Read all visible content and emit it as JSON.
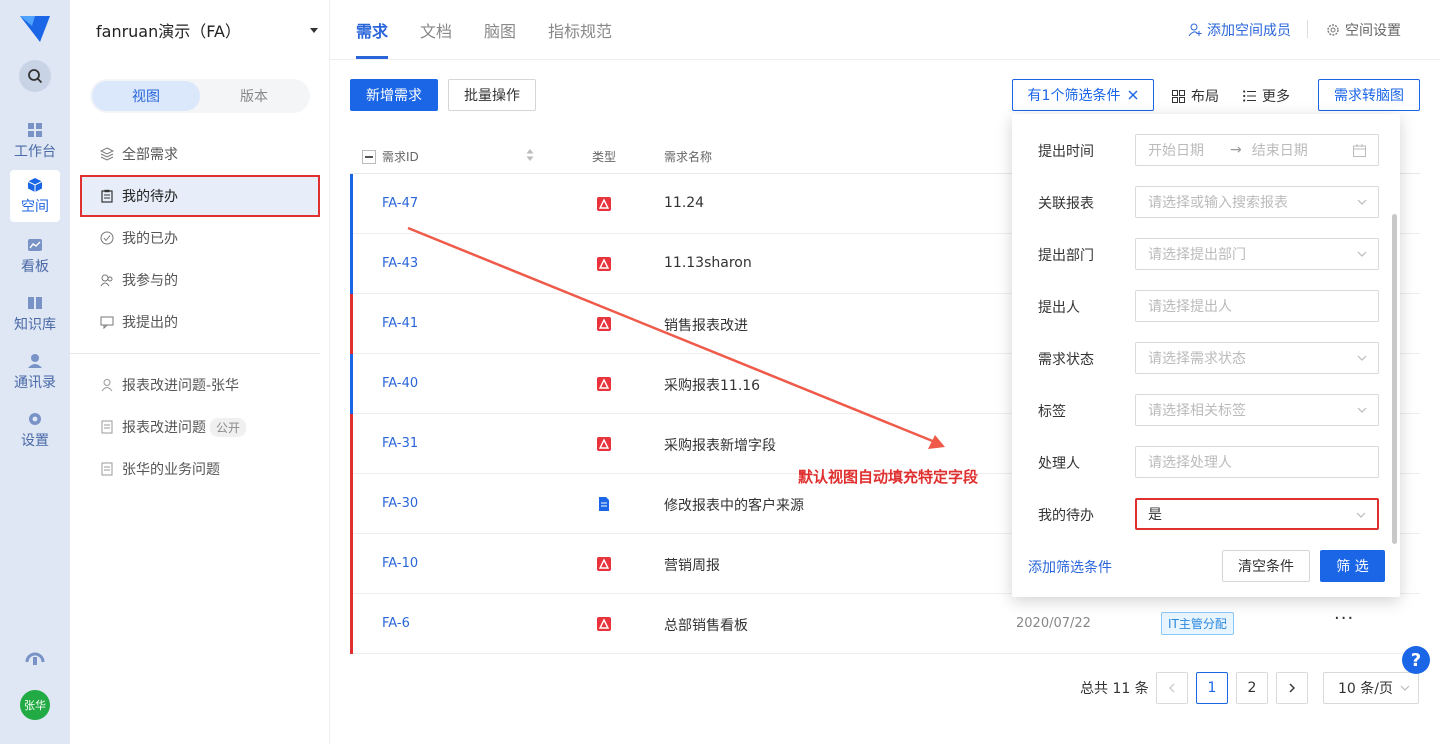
{
  "rail": {
    "items": [
      {
        "label": "工作台",
        "icon": "dashboard-icon"
      },
      {
        "label": "空间",
        "icon": "cube-icon"
      },
      {
        "label": "看板",
        "icon": "chart-icon"
      },
      {
        "label": "知识库",
        "icon": "book-icon"
      },
      {
        "label": "通讯录",
        "icon": "contacts-icon"
      },
      {
        "label": "设置",
        "icon": "gear-icon"
      }
    ],
    "avatar": "张华"
  },
  "sidebar": {
    "space_name": "fanruan演示（FA）",
    "segment": {
      "view": "视图",
      "version": "版本"
    },
    "items": [
      {
        "label": "全部需求"
      },
      {
        "label": "我的待办"
      },
      {
        "label": "我的已办"
      },
      {
        "label": "我参与的"
      },
      {
        "label": "我提出的"
      }
    ],
    "views": [
      {
        "label": "报表改进问题-张华"
      },
      {
        "label": "报表改进问题",
        "badge": "公开"
      },
      {
        "label": "张华的业务问题"
      }
    ]
  },
  "topbar": {
    "tabs": [
      "需求",
      "文档",
      "脑图",
      "指标规范"
    ],
    "add_member": "添加空间成员",
    "settings": "空间设置"
  },
  "toolbar": {
    "new": "新增需求",
    "batch": "批量操作",
    "filter": "有1个筛选条件",
    "layout": "布局",
    "more": "更多",
    "to_mindmap": "需求转脑图"
  },
  "table": {
    "headers": {
      "id": "需求ID",
      "type": "类型",
      "name": "需求名称"
    },
    "rows": [
      {
        "id": "FA-47",
        "name": "11.24",
        "bar": "#1a66e6",
        "type": "report",
        "date": "",
        "tag": ""
      },
      {
        "id": "FA-43",
        "name": "11.13sharon",
        "bar": "#1a66e6",
        "type": "report",
        "date": "",
        "tag": ""
      },
      {
        "id": "FA-41",
        "name": "销售报表改进",
        "bar": "#e02f2f",
        "type": "report",
        "date": "",
        "tag": ""
      },
      {
        "id": "FA-40",
        "name": "采购报表11.16",
        "bar": "#1a66e6",
        "type": "report",
        "date": "",
        "tag": ""
      },
      {
        "id": "FA-31",
        "name": "采购报表新增字段",
        "bar": "#e02f2f",
        "type": "report",
        "date": "",
        "tag": ""
      },
      {
        "id": "FA-30",
        "name": "修改报表中的客户来源",
        "bar": "#e02f2f",
        "type": "doc",
        "date": "",
        "tag": ""
      },
      {
        "id": "FA-10",
        "name": "营销周报",
        "bar": "#e02f2f",
        "type": "report",
        "date": "",
        "tag": ""
      },
      {
        "id": "FA-6",
        "name": "总部销售看板",
        "bar": "#e02f2f",
        "type": "report",
        "date": "2020/07/22",
        "tag": "IT主管分配"
      }
    ],
    "more": "···"
  },
  "pagination": {
    "total": "总共 11 条",
    "pages": [
      "1",
      "2"
    ],
    "size": "10 条/页"
  },
  "filter_popup": {
    "fields": [
      {
        "label": "提出时间",
        "placeholder": "",
        "value": ""
      },
      {
        "label": "关联报表",
        "placeholder": "请选择或输入搜索报表",
        "value": ""
      },
      {
        "label": "提出部门",
        "placeholder": "请选择提出部门",
        "value": ""
      },
      {
        "label": "提出人",
        "placeholder": "请选择提出人",
        "value": ""
      },
      {
        "label": "需求状态",
        "placeholder": "请选择需求状态",
        "value": ""
      },
      {
        "label": "标签",
        "placeholder": "请选择相关标签",
        "value": ""
      },
      {
        "label": "处理人",
        "placeholder": "请选择处理人",
        "value": ""
      },
      {
        "label": "我的待办",
        "placeholder": "",
        "value": "是"
      }
    ],
    "date_start": "开始日期",
    "date_end": "结束日期",
    "add_condition": "添加筛选条件",
    "clear": "清空条件",
    "apply": "筛 选"
  },
  "annotation": "默认视图自动填充特定字段",
  "colors": {
    "primary": "#1a66e6",
    "accent_red": "#e02f2f",
    "rail_bg": "#dfe6f4"
  }
}
